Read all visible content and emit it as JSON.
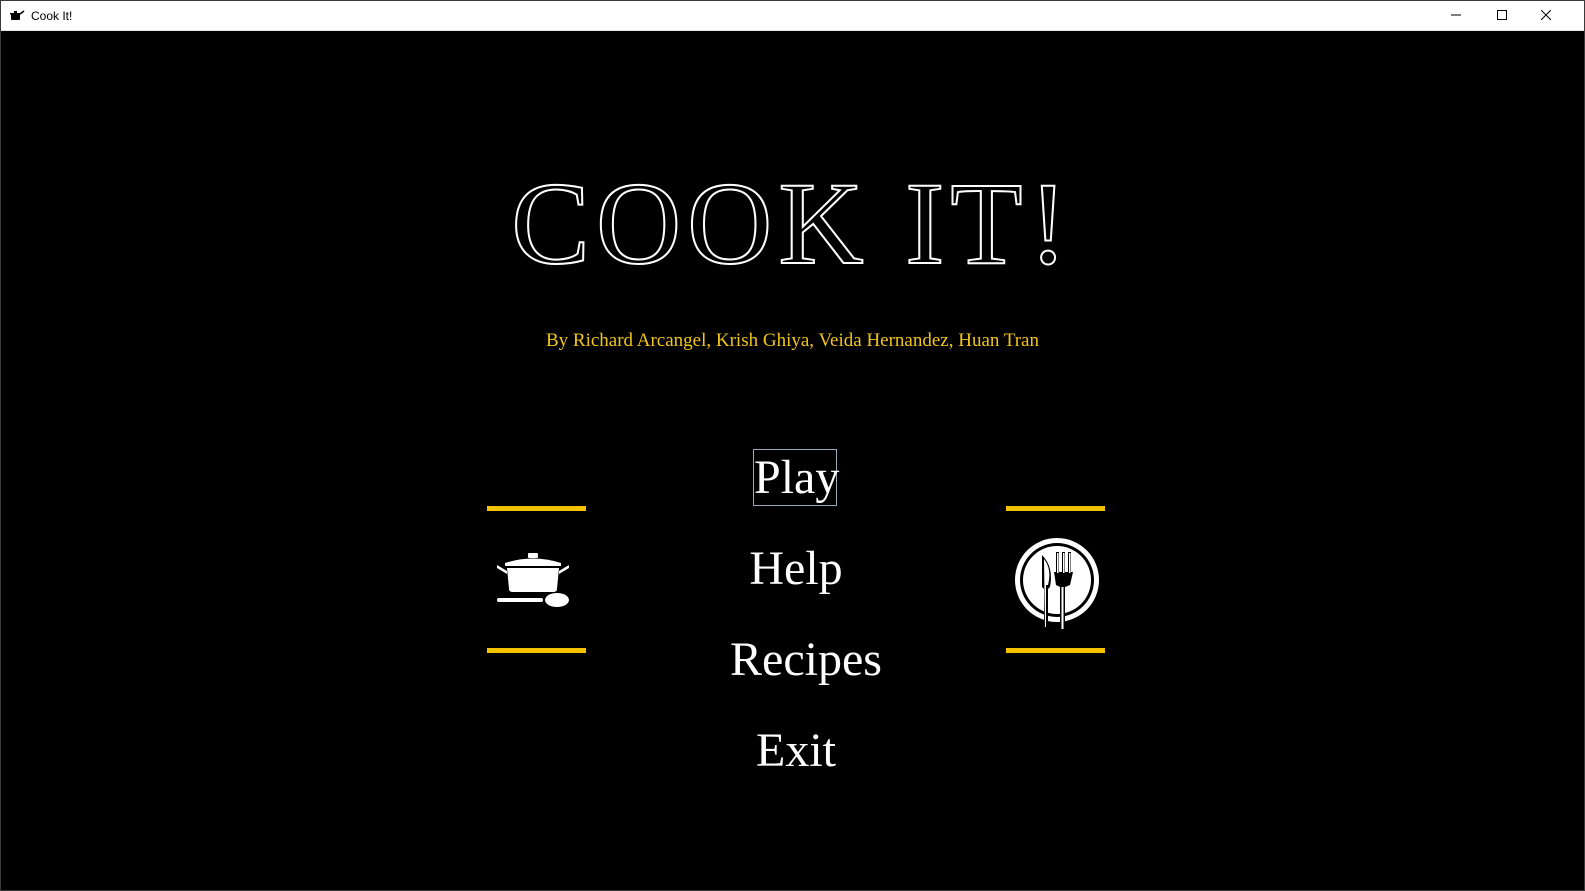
{
  "window": {
    "title": "Cook It!",
    "controls": {
      "minimize": "minimize-icon",
      "maximize": "maximize-icon",
      "close": "close-icon"
    }
  },
  "game": {
    "title": "COOK IT!",
    "credits": "By Richard Arcangel, Krish Ghiya, Veida Hernandez, Huan Tran"
  },
  "menu": {
    "play": "Play",
    "help": "Help",
    "recipes": "Recipes",
    "exit": "Exit"
  },
  "icons": {
    "left": "cooking-pot-icon",
    "right": "plate-cutlery-icon"
  },
  "colors": {
    "background": "#000000",
    "accent": "#f5c200",
    "credits_text": "#f2c41a",
    "menu_text": "#ffffff",
    "selection_border": "#9aa8b8"
  }
}
